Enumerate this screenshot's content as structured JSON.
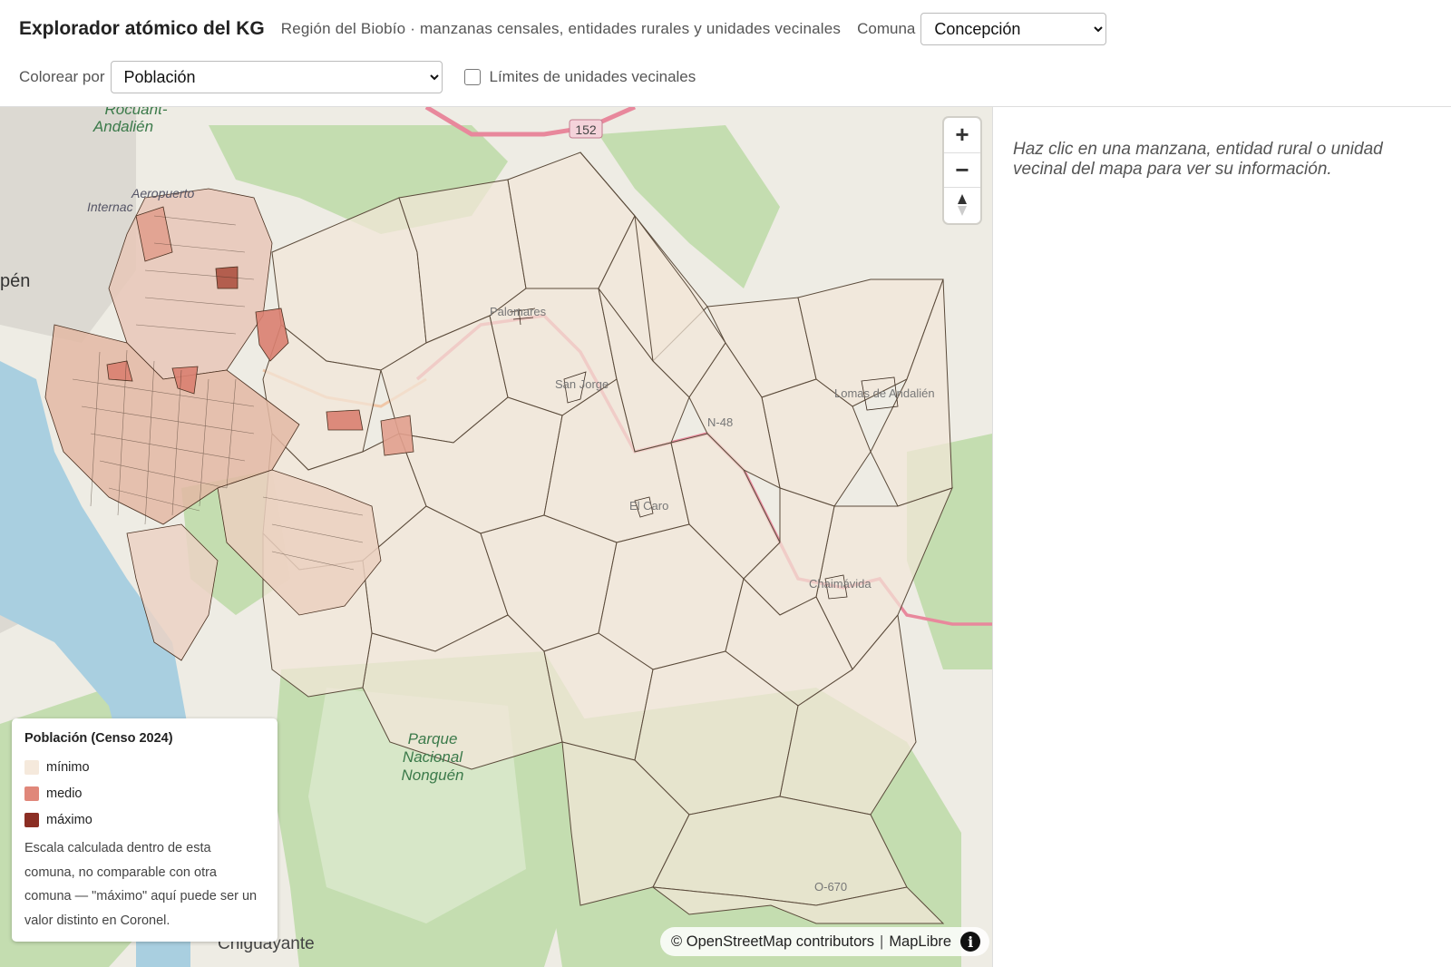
{
  "header": {
    "title": "Explorador atómico del KG",
    "subtitle": "Región del Biobío · manzanas censales, entidades rurales y unidades vecinales",
    "comuna_label": "Comuna",
    "comuna_value": "Concepción",
    "colorear_label": "Colorear por",
    "colorear_value": "Población",
    "limites_label": "Límites de unidades vecinales",
    "limites_checked": false
  },
  "map": {
    "place_labels": [
      "Rocuant-Andalién",
      "Aeropuerto Internacional Carriel Sur",
      "pén",
      "Parque Nacional Nonguén",
      "Chiguayante",
      "152",
      "O-670",
      "El Caro",
      "San Jorge",
      "Palomares",
      "Chaimávida",
      "Lomas de Andalién",
      "N-48"
    ],
    "zoom_in_label": "+",
    "zoom_out_label": "−",
    "compass_icon": "compass-icon"
  },
  "legend": {
    "title": "Población (Censo 2024)",
    "items": [
      {
        "label": "mínimo",
        "color": "#f5e9dc"
      },
      {
        "label": "medio",
        "color": "#e0877a"
      },
      {
        "label": "máximo",
        "color": "#8b2e24"
      }
    ],
    "note": "Escala calculada dentro de esta comuna, no comparable con otra comuna — \"máximo\" aquí puede ser un valor distinto en Coronel."
  },
  "attribution": {
    "osm": "© OpenStreetMap contributors",
    "separator": "|",
    "maplibre": "MapLibre",
    "info_icon": "info-icon"
  },
  "panel": {
    "hint": "Haz clic en una manzana, entidad rural o unidad vecinal del mapa para ver su información."
  },
  "colors": {
    "polygon_fill": "#f2e6d8",
    "polygon_stroke": "#5a4a3a",
    "forest": "#b9d8a6",
    "river": "#a9cfe0",
    "road": "#e8889c"
  }
}
